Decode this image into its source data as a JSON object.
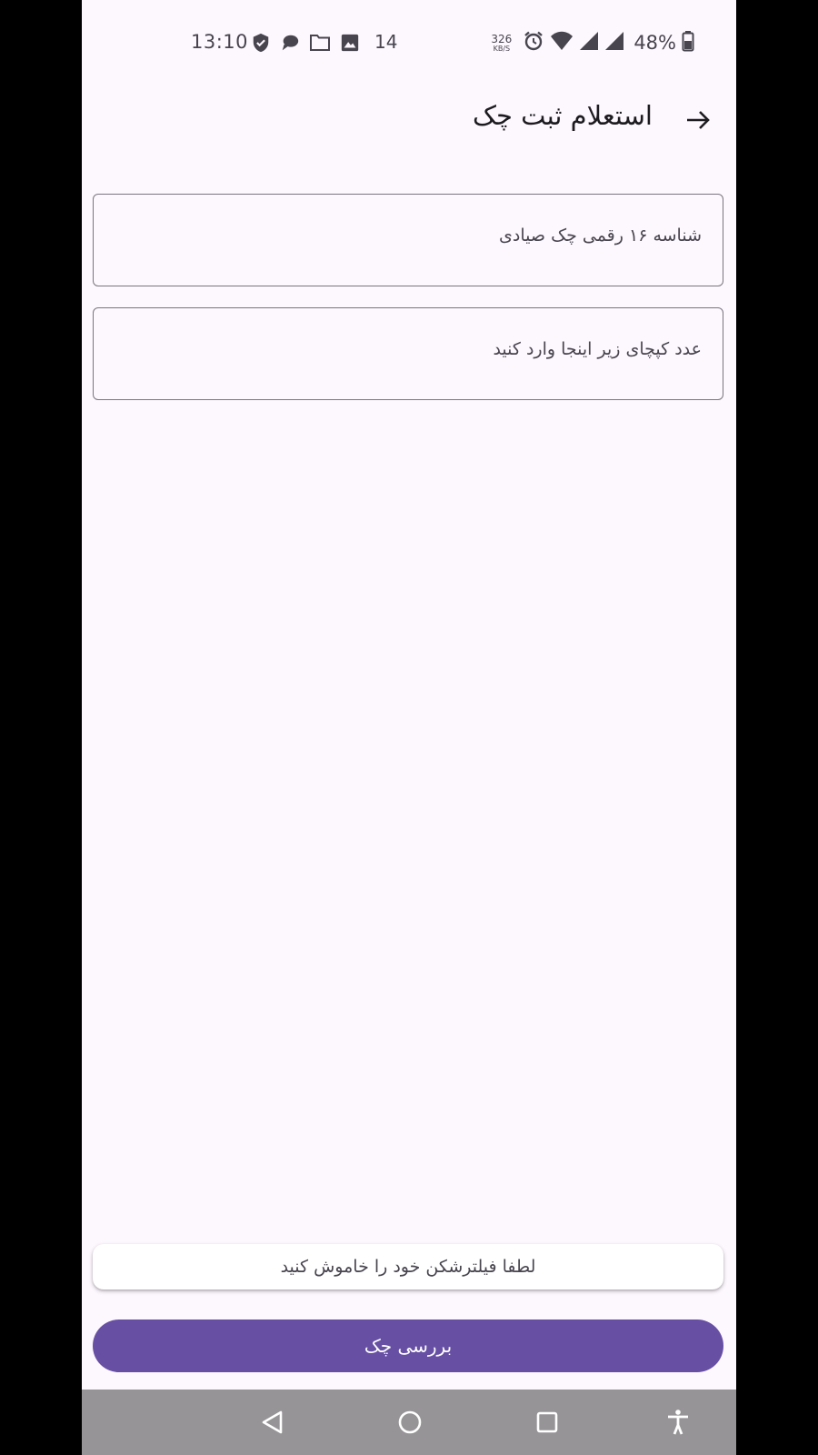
{
  "status_bar": {
    "time": "13:10",
    "notification_count": "14",
    "net_speed_value": "326",
    "net_speed_unit": "KB/S",
    "battery": "48%",
    "icons_left": [
      "verified-shield-icon",
      "chat-bubble-icon",
      "folder-icon",
      "image-icon"
    ],
    "icons_right": [
      "alarm-icon",
      "wifi-icon",
      "signal-icon",
      "signal-icon",
      "battery-icon"
    ]
  },
  "header": {
    "title": "استعلام ثبت چک",
    "back_icon": "arrow-back-icon"
  },
  "form": {
    "cheque_id_placeholder": "شناسه ۱۶ رقمی چک صیادی",
    "captcha_placeholder": "عدد کپچای زیر اینجا وارد کنید"
  },
  "toast": {
    "message": "لطفا فیلترشکن خود را خاموش کنید"
  },
  "actions": {
    "check_label": "بررسی چک"
  },
  "colors": {
    "background": "#fdf7fe",
    "primary": "#6750a4",
    "outline": "#7a757f",
    "nav_bar": "#979497"
  },
  "nav_bar": {
    "icons": [
      "nav-back-icon",
      "nav-home-icon",
      "nav-recents-icon",
      "accessibility-icon"
    ]
  }
}
